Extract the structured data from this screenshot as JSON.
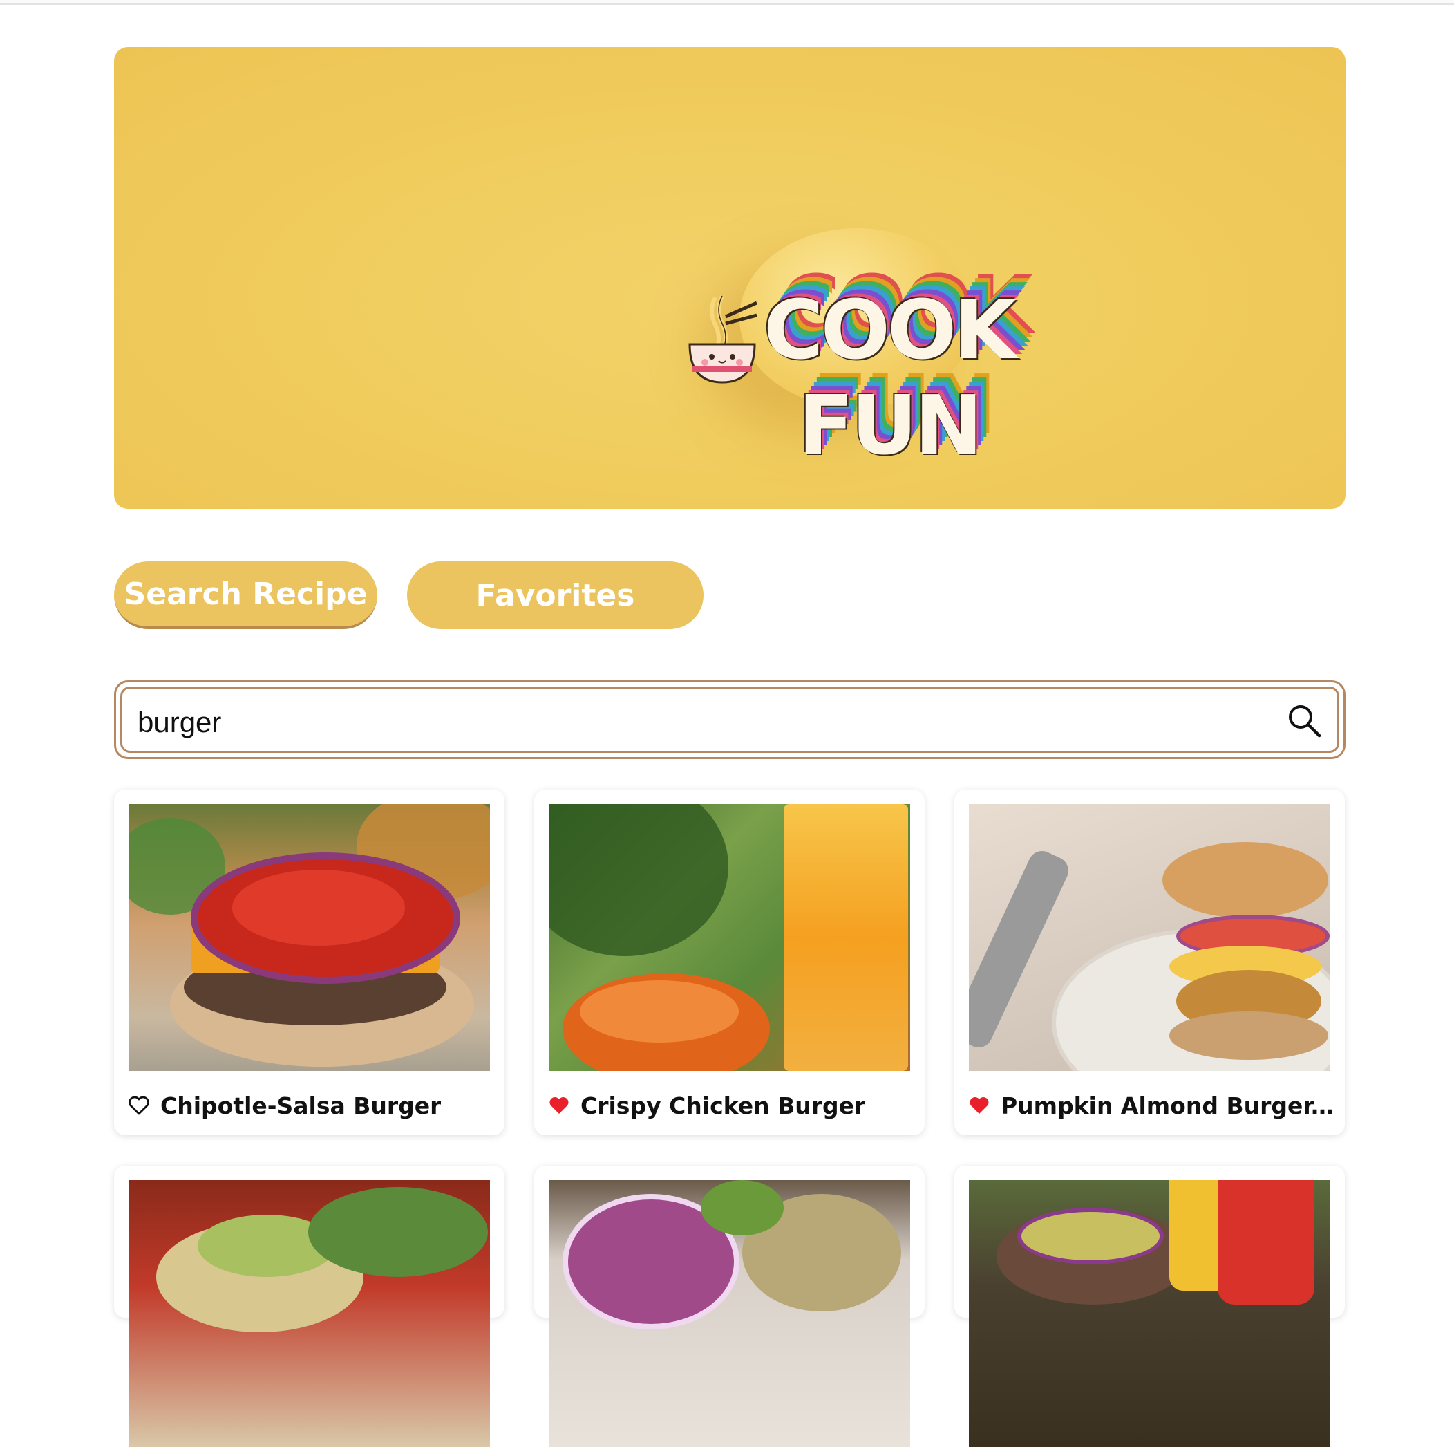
{
  "header": {
    "logo_line1": "COOK",
    "logo_line2": "FUN"
  },
  "tabs": [
    {
      "label": "Search Recipe",
      "active": true
    },
    {
      "label": "Favorites",
      "active": false
    }
  ],
  "search": {
    "value": "burger",
    "icon": "search-icon"
  },
  "recipes": [
    {
      "title": "Chipotle-Salsa Burger",
      "favorited": false
    },
    {
      "title": "Crispy Chicken Burger",
      "favorited": true
    },
    {
      "title": "Pumpkin Almond Burger...",
      "favorited": true
    },
    {
      "title": "",
      "favorited": false
    },
    {
      "title": "",
      "favorited": false
    },
    {
      "title": "",
      "favorited": false
    }
  ],
  "colors": {
    "accent": "#ebc460",
    "tab_border": "#b88b4a",
    "search_border": "#b58863",
    "heart_filled": "#e8202a"
  }
}
